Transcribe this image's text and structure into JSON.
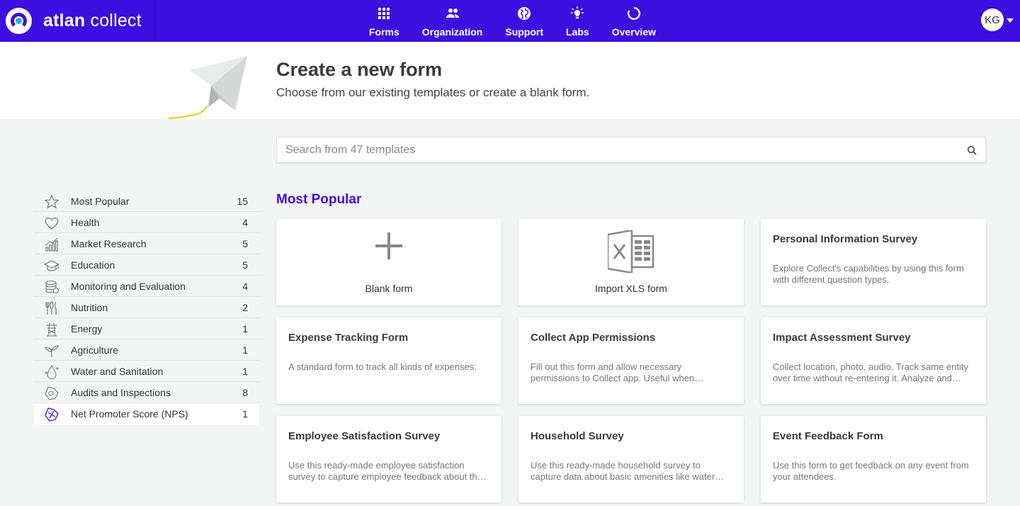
{
  "nav": {
    "brand_bold": "atlan",
    "brand_rest": " collect",
    "items": [
      {
        "label": "Forms",
        "icon": "grid-icon"
      },
      {
        "label": "Organization",
        "icon": "people-icon"
      },
      {
        "label": "Support",
        "icon": "globe-icon"
      },
      {
        "label": "Labs",
        "icon": "bulb-icon"
      },
      {
        "label": "Overview",
        "icon": "loader-icon"
      }
    ],
    "avatar": "KG"
  },
  "hero": {
    "title": "Create a new form",
    "subtitle": "Choose from our existing templates or create a blank form."
  },
  "search": {
    "placeholder": "Search from 47 templates",
    "value": ""
  },
  "categories": [
    {
      "name": "Most Popular",
      "count": "15",
      "icon": "star-icon"
    },
    {
      "name": "Health",
      "count": "4",
      "icon": "heart-icon"
    },
    {
      "name": "Market Research",
      "count": "5",
      "icon": "bar-chart-icon"
    },
    {
      "name": "Education",
      "count": "5",
      "icon": "graduation-cap-icon"
    },
    {
      "name": "Monitoring and Evaluation",
      "count": "4",
      "icon": "database-icon"
    },
    {
      "name": "Nutrition",
      "count": "2",
      "icon": "cutlery-icon"
    },
    {
      "name": "Energy",
      "count": "1",
      "icon": "power-tower-icon"
    },
    {
      "name": "Agriculture",
      "count": "1",
      "icon": "sprout-icon"
    },
    {
      "name": "Water and Sanitation",
      "count": "1",
      "icon": "water-drop-icon"
    },
    {
      "name": "Audits and Inspections",
      "count": "8",
      "icon": "inspection-icon"
    },
    {
      "name": "Net Promoter Score (NPS)",
      "count": "1",
      "icon": "nps-icon"
    }
  ],
  "section": {
    "title": "Most Popular"
  },
  "cards": {
    "blank": {
      "label": "Blank form"
    },
    "import": {
      "label": "Import XLS form"
    },
    "templates": [
      {
        "title": "Personal Information Survey",
        "desc": "Explore Collect's capabilities by using this form with different question types."
      },
      {
        "title": "Expense Tracking Form",
        "desc": "A standard form to track all kinds of expenses."
      },
      {
        "title": "Collect App Permissions",
        "desc": "Fill out this form and allow necessary permissions to Collect app. Useful when collecting data on the go."
      },
      {
        "title": "Impact Assessment Survey",
        "desc": "Collect location, photo, audio. Track same entity over time without re-entering it. Analyze and visualize it. Ensure..."
      },
      {
        "title": "Employee Satisfaction Survey",
        "desc": "Use this ready-made employee satisfaction survey to capture employee feedback about their workplace. Ensure..."
      },
      {
        "title": "Household Survey",
        "desc": "Use this ready-made household survey to capture data about basic amenities like water and electricity. Ensure..."
      },
      {
        "title": "Event Feedback Form",
        "desc": "Use this form to get feedback on any event from your attendees."
      }
    ]
  },
  "colors": {
    "brand": "#3c0fe0",
    "accent_blue": "#21b4e8",
    "accent_yellow": "#f2c318"
  }
}
